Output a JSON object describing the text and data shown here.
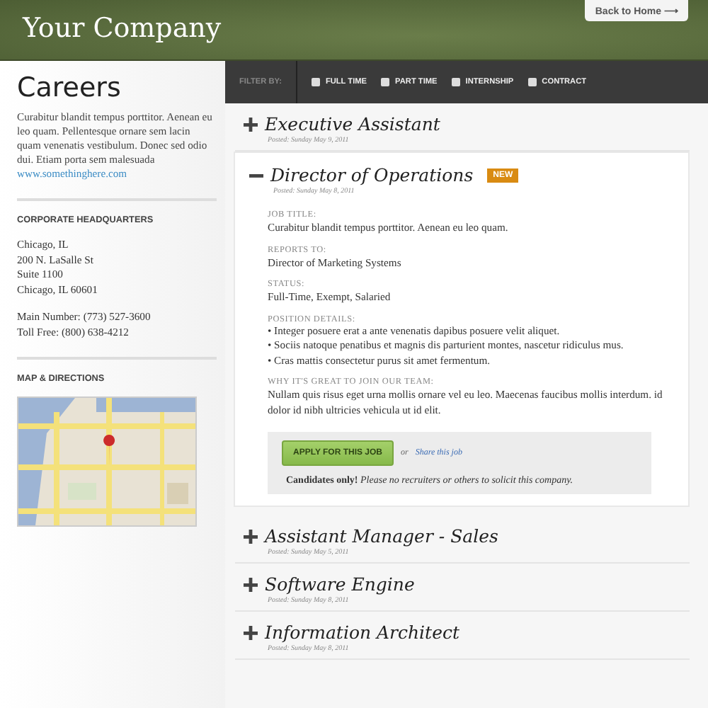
{
  "header": {
    "logo": "Your Company",
    "back_button": "Back to Home ⟶"
  },
  "sidebar": {
    "title": "Careers",
    "intro": "Curabitur blandit tempus porttitor. Aenean eu leo quam. Pellentesque ornare sem lacin quam venenatis vestibulum. Donec sed odio dui. Etiam porta sem malesuada",
    "link": "www.somethinghere.com",
    "hq_heading": "CORPORATE HEADQUARTERS",
    "address": [
      "Chicago, IL",
      "200 N. LaSalle St",
      "Suite 1100",
      "Chicago, IL 60601"
    ],
    "phones": [
      "Main Number: (773) 527-3600",
      "Toll Free: (800) 638-4212"
    ],
    "map_heading": "MAP & DIRECTIONS",
    "map": {
      "kind": "picture"
    }
  },
  "filter": {
    "label": "FILTER BY:",
    "options": [
      {
        "label": "FULL TIME",
        "checked": false
      },
      {
        "label": "PART TIME",
        "checked": false
      },
      {
        "label": "INTERNSHIP",
        "checked": false
      },
      {
        "label": "CONTRACT",
        "checked": false
      }
    ]
  },
  "jobs": [
    {
      "title": "Executive Assistant",
      "posted": "Posted: Sunday May 9, 2011",
      "expanded": false
    },
    {
      "title": "Director of Operations",
      "badge": "NEW",
      "posted": "Posted: Sunday May 8, 2011",
      "expanded": true,
      "details": [
        {
          "label": "JOB TITLE:",
          "text": "Curabitur blandit tempus porttitor. Aenean eu leo quam."
        },
        {
          "label": "REPORTS TO:",
          "text": "Director of Marketing Systems"
        },
        {
          "label": "STATUS:",
          "text": "Full-Time, Exempt, Salaried"
        },
        {
          "label": "POSITION DETAILS:",
          "bullets": [
            "• Integer posuere erat a ante venenatis dapibus posuere velit aliquet.",
            "• Sociis natoque penatibus et magnis dis parturient montes, nascetur ridiculus mus.",
            "• Cras mattis consectetur purus sit amet fermentum."
          ]
        },
        {
          "label": "WHY IT'S GREAT TO JOIN OUR TEAM:",
          "text": "Nullam quis risus eget urna mollis ornare vel eu leo. Maecenas faucibus mollis interdum. id dolor id nibh ultricies vehicula ut id elit."
        }
      ],
      "apply_button": "APPLY FOR THIS JOB",
      "or": "or",
      "share_link": "Share this job",
      "note": "**Candidates only!** *Please no recruiters or others to solicit this company.*"
    },
    {
      "title": "Assistant Manager - Sales",
      "posted": "Posted: Sunday May 5, 2011",
      "expanded": false
    },
    {
      "title": "Software Engine",
      "posted": "Posted: Sunday May 8, 2011",
      "expanded": false
    },
    {
      "title": "Information Architect",
      "posted": "Posted: Sunday May 8, 2011",
      "expanded": false
    }
  ]
}
